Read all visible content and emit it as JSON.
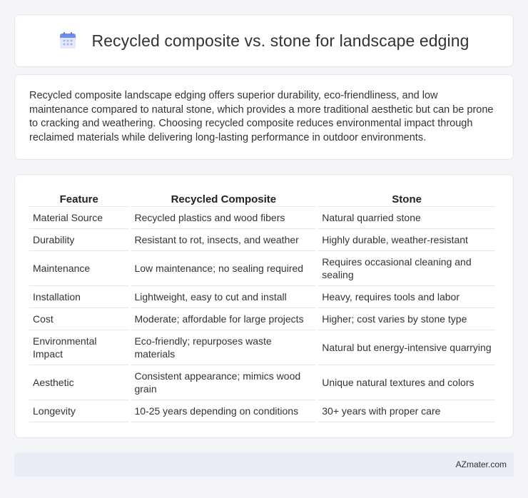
{
  "header": {
    "title": "Recycled composite vs. stone for landscape edging",
    "icon": "calendar-icon",
    "icon_colors": {
      "top": "#6f8df0",
      "body": "#e3e9fb",
      "dots": "#9aaef5"
    }
  },
  "intro": {
    "text": "Recycled composite landscape edging offers superior durability, eco-friendliness, and low maintenance compared to natural stone, which provides a more traditional aesthetic but can be prone to cracking and weathering. Choosing recycled composite reduces environmental impact through reclaimed materials while delivering long-lasting performance in outdoor environments."
  },
  "table": {
    "headers": [
      "Feature",
      "Recycled Composite",
      "Stone"
    ],
    "rows": [
      [
        "Material Source",
        "Recycled plastics and wood fibers",
        "Natural quarried stone"
      ],
      [
        "Durability",
        "Resistant to rot, insects, and weather",
        "Highly durable, weather-resistant"
      ],
      [
        "Maintenance",
        "Low maintenance; no sealing required",
        "Requires occasional cleaning and sealing"
      ],
      [
        "Installation",
        "Lightweight, easy to cut and install",
        "Heavy, requires tools and labor"
      ],
      [
        "Cost",
        "Moderate; affordable for large projects",
        "Higher; cost varies by stone type"
      ],
      [
        "Environmental Impact",
        "Eco-friendly; repurposes waste materials",
        "Natural but energy-intensive quarrying"
      ],
      [
        "Aesthetic",
        "Consistent appearance; mimics wood grain",
        "Unique natural textures and colors"
      ],
      [
        "Longevity",
        "10-25 years depending on conditions",
        "30+ years with proper care"
      ]
    ]
  },
  "footer": {
    "brand": "AZmater.com"
  }
}
